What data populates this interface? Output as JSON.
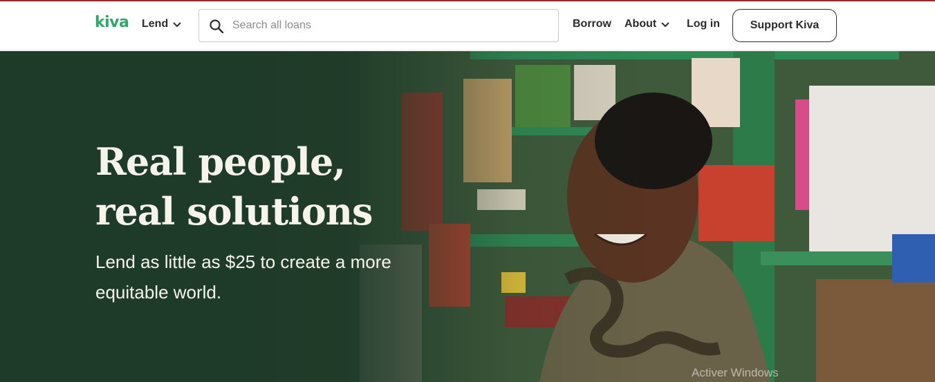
{
  "header": {
    "logo": "kiva",
    "nav": {
      "lend": "Lend",
      "borrow": "Borrow",
      "about": "About",
      "login": "Log in"
    },
    "search": {
      "placeholder": "Search all loans",
      "value": ""
    },
    "support_button": "Support Kiva"
  },
  "hero": {
    "title_line1": "Real people,",
    "title_line2": "real solutions",
    "subtitle_line1": "Lend as little as $25 to create a more",
    "subtitle_line2": "equitable world."
  },
  "system": {
    "watermark": "Activer Windows"
  },
  "colors": {
    "brand_green": "#2aa967",
    "hero_background": "#1e3a28",
    "text_dark": "#2b2b2b",
    "hero_text": "#f6f3ea"
  },
  "icons": [
    "search-icon",
    "chevron-down-icon"
  ]
}
